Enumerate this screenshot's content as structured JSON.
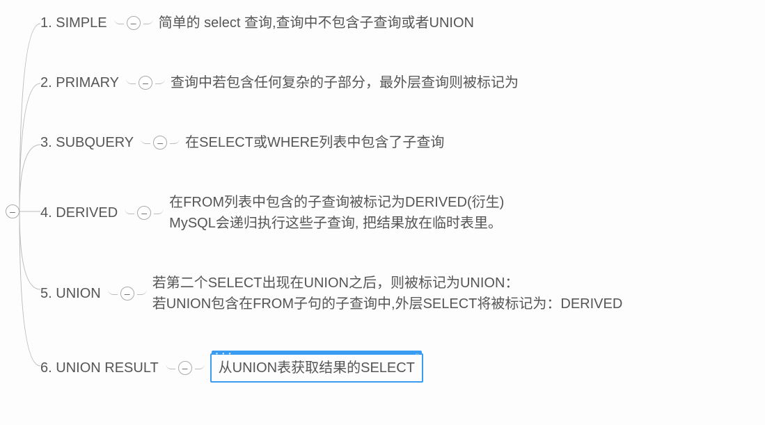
{
  "items": [
    {
      "num": "1.",
      "label": "SIMPLE",
      "desc": "简单的 select 查询,查询中不包含子查询或者UNION"
    },
    {
      "num": "2.",
      "label": "PRIMARY",
      "desc": "查询中若包含任何复杂的子部分，最外层查询则被标记为"
    },
    {
      "num": "3.",
      "label": "SUBQUERY",
      "desc": "在SELECT或WHERE列表中包含了子查询"
    },
    {
      "num": "4.",
      "label": "DERIVED",
      "desc": "在FROM列表中包含的子查询被标记为DERIVED(衍生)\nMySQL会递归执行这些子查询, 把结果放在临时表里。"
    },
    {
      "num": "5.",
      "label": "UNION",
      "desc": "若第二个SELECT出现在UNION之后，则被标记为UNION：\n若UNION包含在FROM子句的子查询中,外层SELECT将被标记为：DERIVED"
    },
    {
      "num": "6.",
      "label": "UNION RESULT",
      "desc": "从UNION表获取结果的SELECT",
      "selected": true
    }
  ],
  "toggle_symbol": "–"
}
